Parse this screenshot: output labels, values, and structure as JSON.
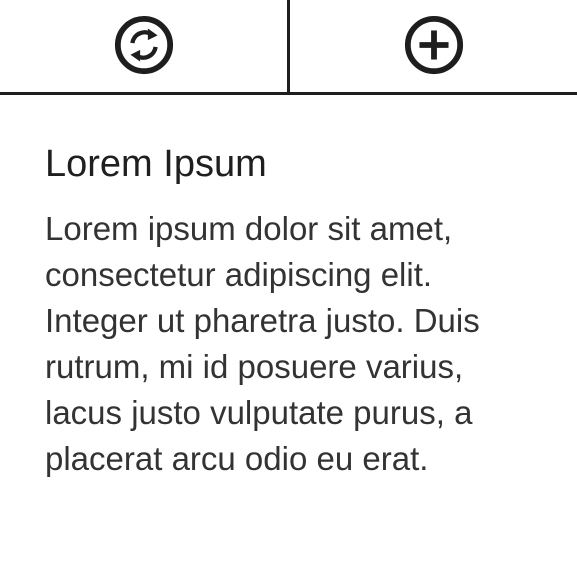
{
  "toolbar": {
    "left_icon": "refresh-icon",
    "right_icon": "add-icon"
  },
  "card": {
    "title": "Lorem Ipsum",
    "body": "Lorem ipsum dolor sit amet, consectetur adipiscing elit. Integer ut pharetra justo. Duis rutrum, mi id posuere varius, lacus justo vulputate purus, a placerat arcu odio eu erat."
  },
  "colors": {
    "line": "#1e1e1e",
    "text": "#333333"
  }
}
